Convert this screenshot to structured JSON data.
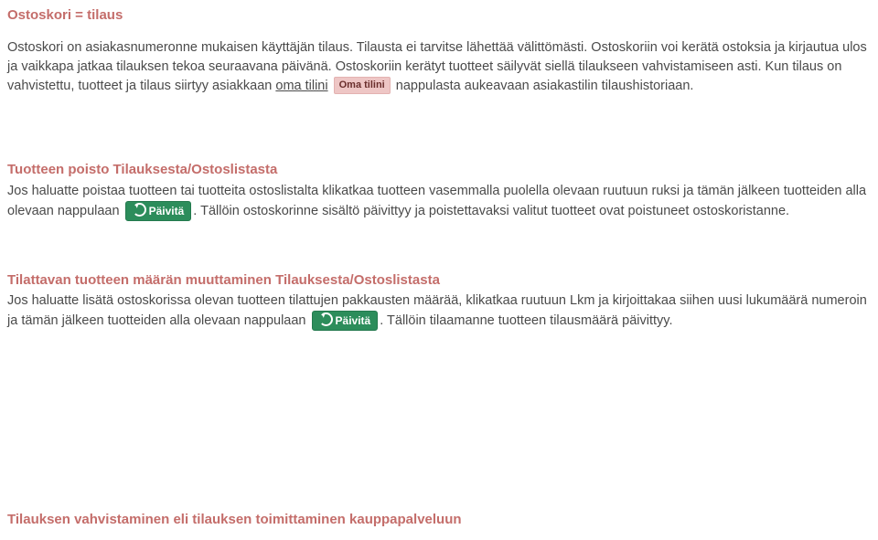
{
  "s1": {
    "title": "Ostoskori = tilaus",
    "p1a": "Ostoskori on asiakasnumeronne mukaisen käyttäjän tilaus. Tilausta ei tarvitse lähettää välittömästi. Ostoskoriin voi kerätä ostoksia ja kirjautua ulos ja vaikkapa jatkaa tilauksen tekoa seuraavana päivänä. Ostoskoriin kerätyt tuotteet säilyvät siellä tilaukseen vahvistamiseen asti. Kun tilaus on vahvistettu, tuotteet ja tilaus siirtyy asiakkaan ",
    "p1_link": "oma tilini",
    "p1_pill": "Oma tilini",
    "p1b": " nappulasta aukeavaan asiakastilin tilaushistoriaan."
  },
  "s2": {
    "title": "Tuotteen poisto Tilauksesta/Ostoslistasta",
    "p1a": "Jos haluatte poistaa tuotteen tai tuotteita ostoslistalta klikatkaa tuotteen vasemmalla puolella olevaan ruutuun ruksi ja tämän jälkeen tuotteiden alla olevaan nappulaan ",
    "btn1": "Päivitä",
    "p1b": ". Tällöin ostoskorinne sisältö päivittyy ja poistettavaksi valitut tuotteet ovat poistuneet ostoskoristanne."
  },
  "s3": {
    "title": "Tilattavan tuotteen määrän muuttaminen Tilauksesta/Ostoslistasta",
    "p1a": "Jos haluatte lisätä ostoskorissa olevan tuotteen tilattujen pakkausten määrää, klikatkaa ruutuun Lkm ja kirjoittakaa siihen uusi lukumäärä numeroin ja  tämän jälkeen tuotteiden alla olevaan nappulaan ",
    "btn1": "Päivitä",
    "p1b": ". Tällöin tilaamanne tuotteen tilausmäärä päivittyy."
  },
  "s4": {
    "title": "Tilauksen vahvistaminen eli tilauksen toimittaminen kauppapalveluun"
  }
}
